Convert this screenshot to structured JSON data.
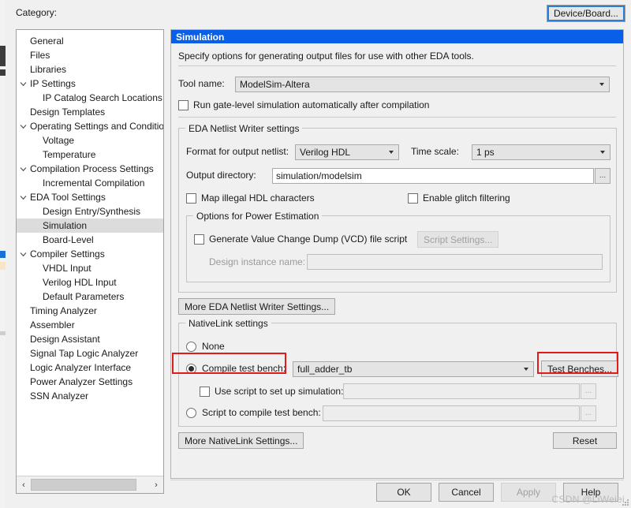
{
  "header": {
    "category_label": "Category:",
    "device_board_button": "Device/Board..."
  },
  "tree": {
    "items": [
      {
        "label": "General",
        "indent": 0,
        "twisty": "none",
        "selected": false
      },
      {
        "label": "Files",
        "indent": 0,
        "twisty": "none",
        "selected": false
      },
      {
        "label": "Libraries",
        "indent": 0,
        "twisty": "none",
        "selected": false
      },
      {
        "label": "IP Settings",
        "indent": 0,
        "twisty": "expanded",
        "selected": false
      },
      {
        "label": "IP Catalog Search Locations",
        "indent": 1,
        "twisty": "none",
        "selected": false
      },
      {
        "label": "Design Templates",
        "indent": 0,
        "twisty": "none",
        "selected": false
      },
      {
        "label": "Operating Settings and Conditions",
        "indent": 0,
        "twisty": "expanded",
        "selected": false
      },
      {
        "label": "Voltage",
        "indent": 1,
        "twisty": "none",
        "selected": false
      },
      {
        "label": "Temperature",
        "indent": 1,
        "twisty": "none",
        "selected": false
      },
      {
        "label": "Compilation Process Settings",
        "indent": 0,
        "twisty": "expanded",
        "selected": false
      },
      {
        "label": "Incremental Compilation",
        "indent": 1,
        "twisty": "none",
        "selected": false
      },
      {
        "label": "EDA Tool Settings",
        "indent": 0,
        "twisty": "expanded",
        "selected": false
      },
      {
        "label": "Design Entry/Synthesis",
        "indent": 1,
        "twisty": "none",
        "selected": false
      },
      {
        "label": "Simulation",
        "indent": 1,
        "twisty": "none",
        "selected": true
      },
      {
        "label": "Board-Level",
        "indent": 1,
        "twisty": "none",
        "selected": false
      },
      {
        "label": "Compiler Settings",
        "indent": 0,
        "twisty": "expanded",
        "selected": false
      },
      {
        "label": "VHDL Input",
        "indent": 1,
        "twisty": "none",
        "selected": false
      },
      {
        "label": "Verilog HDL Input",
        "indent": 1,
        "twisty": "none",
        "selected": false
      },
      {
        "label": "Default Parameters",
        "indent": 1,
        "twisty": "none",
        "selected": false
      },
      {
        "label": "Timing Analyzer",
        "indent": 0,
        "twisty": "none",
        "selected": false
      },
      {
        "label": "Assembler",
        "indent": 0,
        "twisty": "none",
        "selected": false
      },
      {
        "label": "Design Assistant",
        "indent": 0,
        "twisty": "none",
        "selected": false
      },
      {
        "label": "Signal Tap Logic Analyzer",
        "indent": 0,
        "twisty": "none",
        "selected": false
      },
      {
        "label": "Logic Analyzer Interface",
        "indent": 0,
        "twisty": "none",
        "selected": false
      },
      {
        "label": "Power Analyzer Settings",
        "indent": 0,
        "twisty": "none",
        "selected": false
      },
      {
        "label": "SSN Analyzer",
        "indent": 0,
        "twisty": "none",
        "selected": false
      }
    ],
    "scroll_left_arrow": "‹",
    "scroll_right_arrow": "›"
  },
  "panel": {
    "title": "Simulation",
    "description": "Specify options for generating output files for use with other EDA tools.",
    "tool_name_label": "Tool name:",
    "tool_name_value": "ModelSim-Altera",
    "run_gate_level_label": "Run gate-level simulation automatically after compilation",
    "run_gate_level_checked": false
  },
  "eda_netlist": {
    "group_title": "EDA Netlist Writer settings",
    "format_label": "Format for output netlist:",
    "format_value": "Verilog HDL",
    "timescale_label": "Time scale:",
    "timescale_value": "1 ps",
    "output_dir_label": "Output directory:",
    "output_dir_value": "simulation/modelsim",
    "browse_button": "...",
    "map_illegal_label": "Map illegal HDL characters",
    "map_illegal_checked": false,
    "glitch_label": "Enable glitch filtering",
    "glitch_checked": false,
    "power": {
      "group_title": "Options for Power Estimation",
      "vcd_label": "Generate Value Change Dump (VCD) file script",
      "vcd_checked": false,
      "script_settings_button": "Script Settings...",
      "design_instance_label": "Design instance name:",
      "design_instance_value": ""
    }
  },
  "more_eda_button": "More EDA Netlist Writer Settings...",
  "nativelink": {
    "group_title": "NativeLink settings",
    "none_label": "None",
    "none_selected": false,
    "compile_tb_label": "Compile test bench:",
    "compile_tb_selected": true,
    "compile_tb_value": "full_adder_tb",
    "test_benches_button": "Test Benches...",
    "use_script_label": "Use script to set up simulation:",
    "use_script_checked": false,
    "use_script_value": "",
    "script_compile_label": "Script to compile test bench:",
    "script_compile_selected": false,
    "script_compile_value": "",
    "browse_button": "..."
  },
  "more_nativelink_button": "More NativeLink Settings...",
  "reset_button": "Reset",
  "footer": {
    "ok": "OK",
    "cancel": "Cancel",
    "apply": "Apply",
    "apply_enabled": false,
    "help": "Help"
  },
  "watermark": "CSDN @LiWeiei",
  "colors": {
    "title_bar": "#0a5fe8",
    "highlight_red": "#e01b1b",
    "focus_blue": "#2a7fd4",
    "selection_gray": "#dcdcdc"
  }
}
